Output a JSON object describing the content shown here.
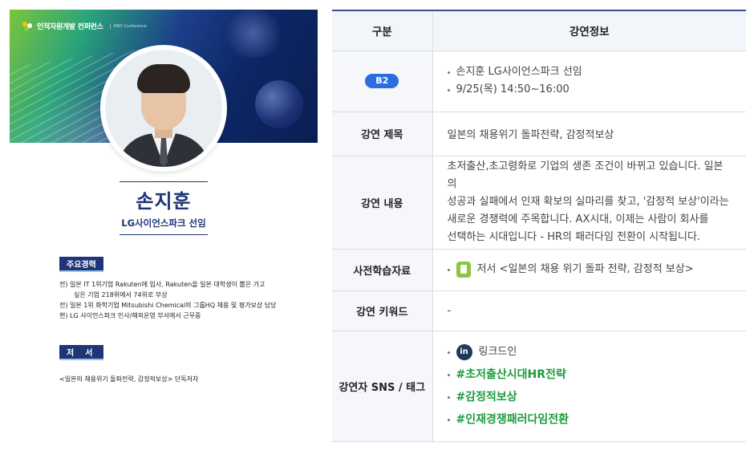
{
  "profile": {
    "banner": {
      "title": "인적자원개발 컨퍼런스",
      "subtitle": "HRD Conference"
    },
    "name": "손지훈",
    "affiliation": "LG사이언스파크 선임",
    "career_heading": "주요경력",
    "career": [
      "전) 일본 IT 1위기업 Rakuten에 입사, Rakuten을 일본 대학생이 뽑은 가고",
      "싶은 기업 218위에서 74위로 부상",
      "전) 일본 1위 화학기업 Mitsubishi Chemical의 그룹HQ 채용 및 평가보상 담당",
      "현) LG 사이언스파크 인사/해외운영 부서에서 근무중"
    ],
    "book_heading": "저서",
    "book": "<일본의 채용위기 돌파전략, 감정적보상> 단독저자"
  },
  "table": {
    "header": {
      "col1": "구분",
      "col2": "강연정보"
    },
    "session": {
      "badge": "B2",
      "items": [
        "손지훈 LG사이언스파크 선임",
        "9/25(목) 14:50~16:00"
      ]
    },
    "title_row": {
      "label": "강연 제목",
      "value": "일본의 채용위기 돌파전략, 감정적보상"
    },
    "content_row": {
      "label": "강연 내용",
      "lines": [
        "초저출산,초고령화로 기업의 생존 조건이 바뀌고 있습니다. 일본의",
        "성공과 실패에서 인재 확보의 실마리를 찾고, '감정적 보상'이라는",
        "새로운 경쟁력에 주목합니다. AX시대, 이제는 사람이 회사를",
        "선택하는 시대입니다 - HR의 패러다임 전환이 시작됩니다."
      ]
    },
    "prep_row": {
      "label": "사전학습자료",
      "value": "저서 <일본의 채용 위기 돌파 전략, 감정적 보상>"
    },
    "keyword_row": {
      "label": "강연 키워드",
      "value": "-"
    },
    "sns_row": {
      "label": "강연자 SNS / 태그",
      "linkedin": "링크드인",
      "tags": [
        "#초저출산시대HR전략",
        "#감정적보상",
        "#인재경쟁패러다임전환"
      ]
    }
  },
  "colors": {
    "navy": "#1f3578",
    "badge_blue": "#2b6de0",
    "tag_green": "#1e9b3c",
    "book_icon_green": "#8cc63f"
  }
}
